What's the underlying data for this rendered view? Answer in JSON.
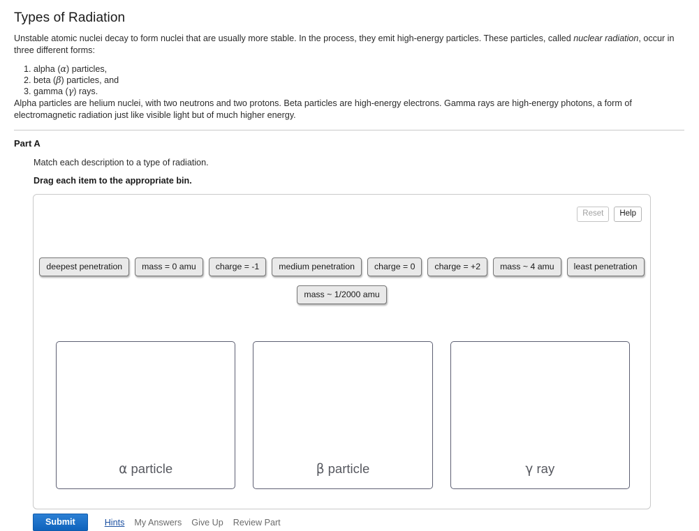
{
  "page": {
    "title": "Types of Radiation",
    "intro_paragraph_pre": "Unstable atomic nuclei decay to form nuclei that are usually more stable. In the process, they emit high-energy particles. These particles, called ",
    "intro_paragraph_em": "nuclear radiation",
    "intro_paragraph_post": ", occur in three different forms:",
    "list_items": [
      {
        "pre": "alpha (",
        "symbol": "α",
        "post": ") particles,"
      },
      {
        "pre": "beta (",
        "symbol": "β",
        "post": ") particles, and"
      },
      {
        "pre": "gamma (",
        "symbol": "γ",
        "post": ") rays."
      }
    ],
    "intro_paragraph_2": "Alpha particles are helium nuclei, with two neutrons and two protons. Beta particles are high-energy electrons. Gamma rays are high-energy photons, a form of electromagnetic radiation just like visible light but of much higher energy."
  },
  "part": {
    "label": "Part A",
    "instruction": "Match each description to a type of radiation.",
    "instruction_bold": "Drag each item to the appropriate bin."
  },
  "panel": {
    "reset_label": "Reset",
    "help_label": "Help",
    "reset_disabled": true,
    "tokens_row1": [
      "deepest penetration",
      "mass = 0 amu",
      "charge = -1",
      "medium penetration",
      "charge = 0",
      "charge = +2",
      "mass ~ 4 amu",
      "least penetration"
    ],
    "tokens_row2": [
      "mass ~ 1/2000 amu"
    ],
    "bins": [
      {
        "symbol": "α",
        "name": " particle"
      },
      {
        "symbol": "β",
        "name": " particle"
      },
      {
        "symbol": "γ",
        "name": " ray"
      }
    ]
  },
  "footer": {
    "submit_label": "Submit",
    "links": [
      {
        "label": "Hints",
        "active": true
      },
      {
        "label": "My Answers",
        "active": false
      },
      {
        "label": "Give Up",
        "active": false
      },
      {
        "label": "Review Part",
        "active": false
      }
    ]
  },
  "colors": {
    "submit_blue": "#1a70c8",
    "link_blue": "#1a4fa0",
    "token_fill": "#e9e9e9",
    "bin_border": "#5d5f72",
    "panel_border": "#c9c9c9"
  }
}
